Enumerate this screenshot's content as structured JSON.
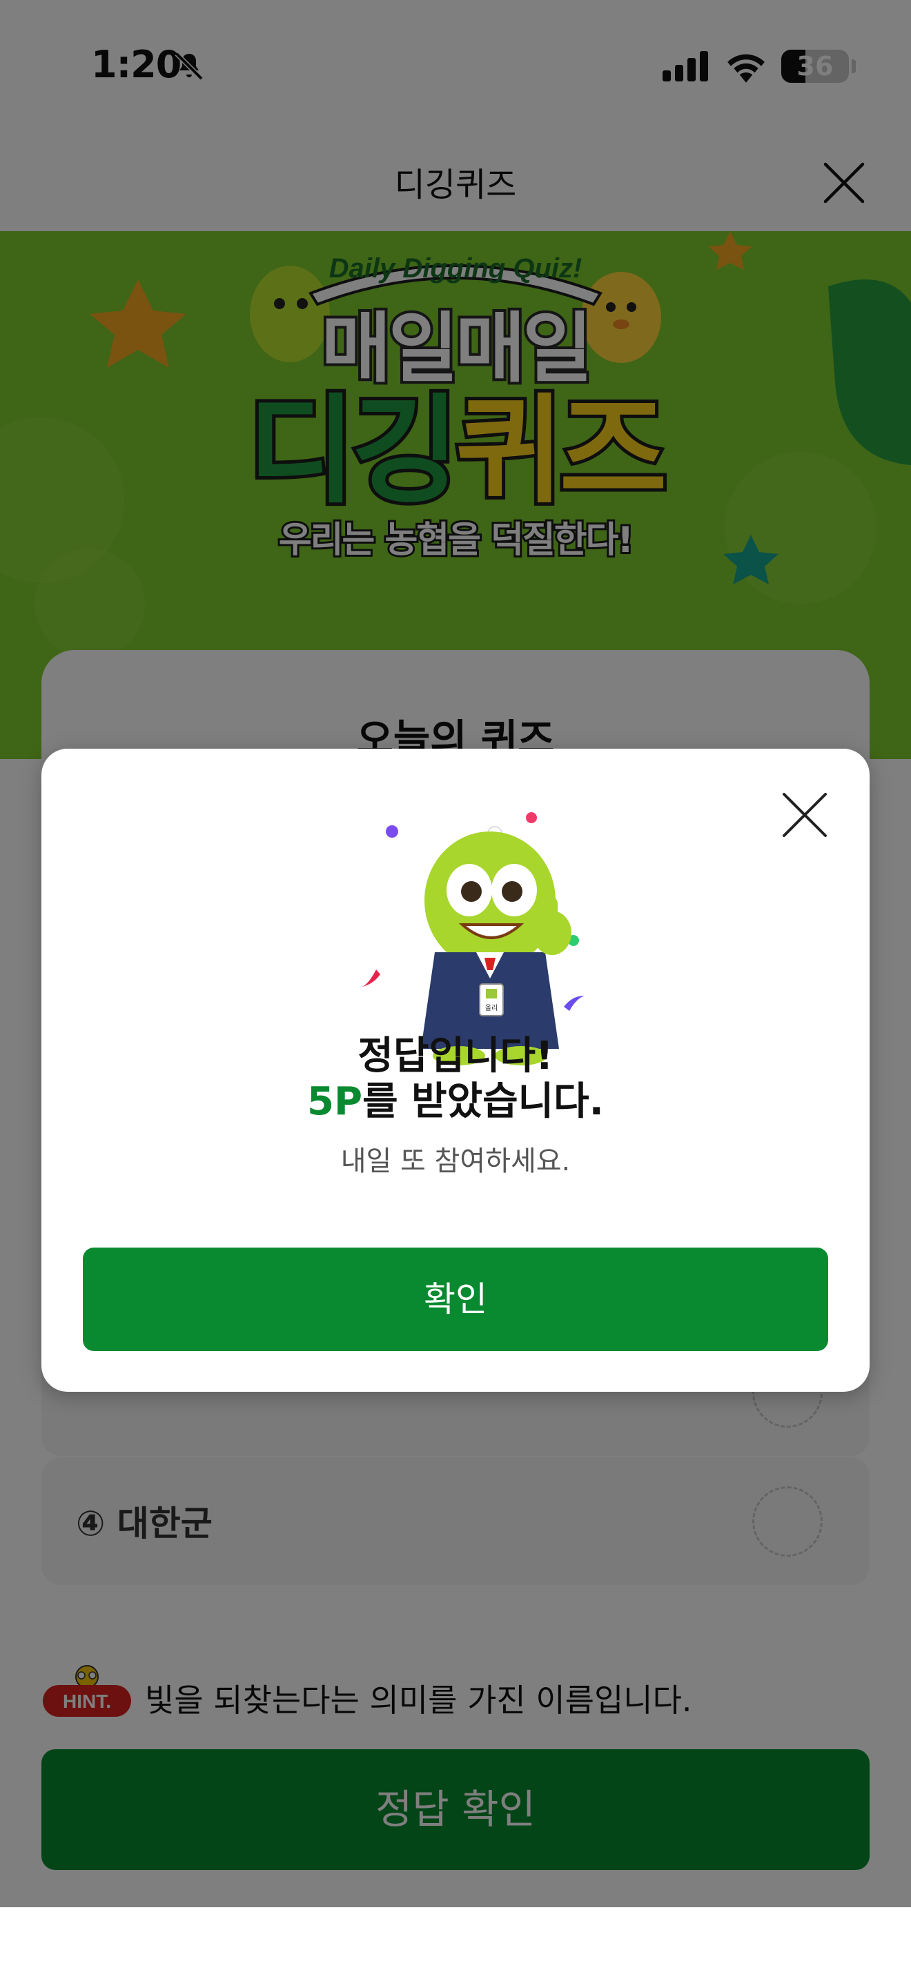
{
  "status_bar": {
    "time": "1:20",
    "battery": "36",
    "battery_level": 0.36,
    "icons": [
      "bell-slash-icon",
      "signal-icon",
      "wifi-icon",
      "battery-icon"
    ]
  },
  "header": {
    "title": "디깅퀴즈",
    "close_icon": "close-icon"
  },
  "banner": {
    "ribbon": "Daily Digging Quiz!",
    "title_line1": "매일매일",
    "title_line2_green": "디깅",
    "title_line2_yellow": "퀴즈",
    "subtitle": "우리는 농협을 덕질한다!"
  },
  "quiz": {
    "card_title": "오늘의 퀴즈",
    "options": [
      {
        "label": "④ 대한군"
      }
    ],
    "hint_badge": "HINT.",
    "hint_text": "빛을 되찾는다는 의미를 가진 이름입니다.",
    "submit_label": "정답 확인"
  },
  "modal": {
    "line1": "정답입니다!",
    "points": "5P",
    "line2_rest": "를 받았습니다.",
    "sub": "내일 또 참여하세요.",
    "confirm_label": "확인",
    "close_icon": "close-icon",
    "mascot_badge": "올리"
  },
  "colors": {
    "brand_green": "#098a30",
    "banner_green": "#7ecb2c",
    "highlight_yellow": "#ffd21f"
  }
}
